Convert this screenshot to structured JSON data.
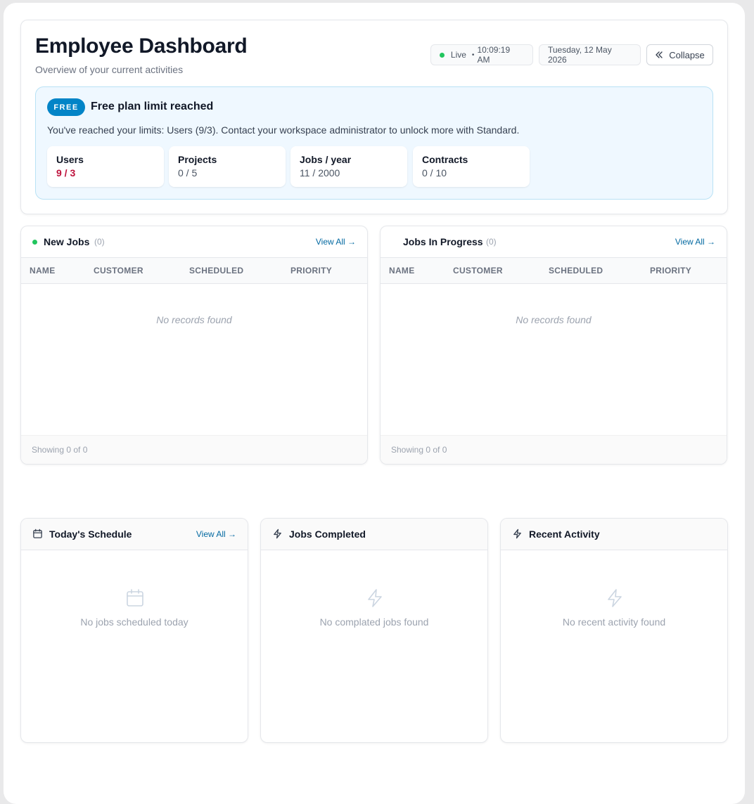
{
  "header": {
    "title": "Employee Dashboard",
    "subtitle": "Overview of your current activities",
    "live_label": "Live",
    "live_sep": "•",
    "live_time": "10:09:19 AM",
    "date": "Tuesday, 12 May 2026",
    "collapse_label": "Collapse",
    "live_color": "#22c55e"
  },
  "plan_alert": {
    "badge": "FREE",
    "title": "Free plan limit reached",
    "message": "You've reached your limits: Users (9/3). Contact your workspace administrator to unlock more with Standard.",
    "limits": [
      {
        "label": "Users",
        "value": "9 / 3",
        "over": true
      },
      {
        "label": "Projects",
        "value": "0 / 5",
        "over": false
      },
      {
        "label": "Jobs / year",
        "value": "11 / 2000",
        "over": false
      },
      {
        "label": "Contracts",
        "value": "0 / 10",
        "over": false
      }
    ],
    "accent": "#0284c7",
    "over_color": "#be123c"
  },
  "new_jobs": {
    "title": "New Jobs",
    "count": "(0)",
    "view_all": "View All →",
    "columns": [
      "NAME",
      "CUSTOMER",
      "SCHEDULED",
      "PRIORITY"
    ],
    "empty": "No records found",
    "footer": "Showing 0 of 0"
  },
  "jobs_in_progress": {
    "title": "Jobs In Progress",
    "count": "(0)",
    "view_all": "View All →",
    "columns": [
      "NAME",
      "CUSTOMER",
      "SCHEDULED",
      "PRIORITY"
    ],
    "empty": "No records found",
    "footer": "Showing 0 of 0"
  },
  "todays_schedule": {
    "title": "Today's Schedule",
    "view_all": "View All →",
    "empty": "No jobs scheduled today",
    "icon": "calendar-icon"
  },
  "jobs_completed": {
    "title": "Jobs Completed",
    "empty": "No complated jobs found",
    "icon": "lightning-icon"
  },
  "recent_activity": {
    "title": "Recent Activity",
    "empty": "No recent activity found",
    "icon": "lightning-icon"
  }
}
